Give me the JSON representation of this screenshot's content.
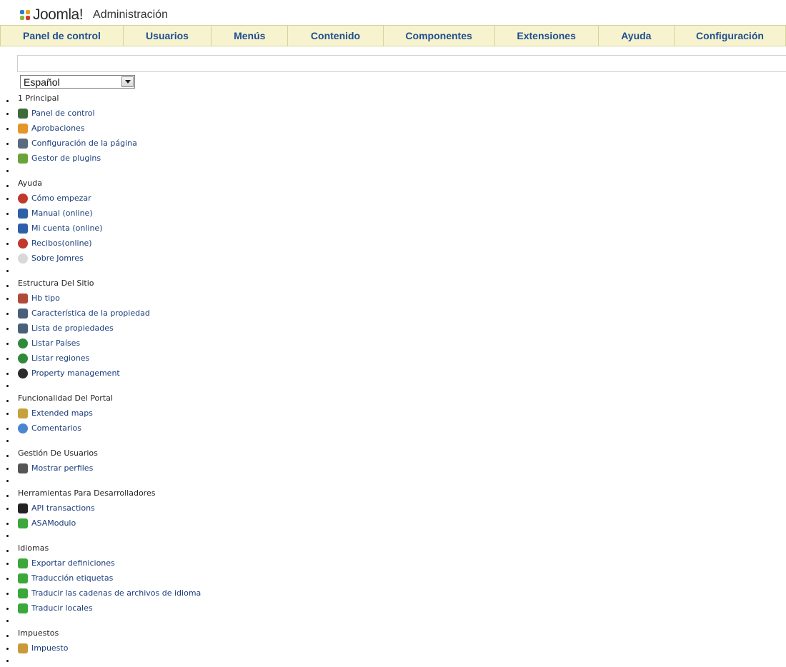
{
  "header": {
    "logo_text": "Joomla!",
    "title": "Administración"
  },
  "nav": [
    {
      "label": "Panel de control",
      "w": 172
    },
    {
      "label": "Usuarios",
      "w": 123
    },
    {
      "label": "Menús",
      "w": 107
    },
    {
      "label": "Contenido",
      "w": 133
    },
    {
      "label": "Componentes",
      "w": 156
    },
    {
      "label": "Extensiones",
      "w": 145
    },
    {
      "label": "Ayuda",
      "w": 106
    },
    {
      "label": "Configuración",
      "w": 156
    }
  ],
  "language_select": {
    "value": "Español"
  },
  "colors": {
    "menubar_bg": "#f7f3cf",
    "menubar_text": "#1f4f8f",
    "link": "#1a3d7a"
  },
  "sections": [
    {
      "title": "1 Principal",
      "items": [
        {
          "label": "Panel de control",
          "icon": "monitor-icon",
          "color": "#3f6b3a"
        },
        {
          "label": "Aprobaciones",
          "icon": "thumbs-up-icon",
          "color": "#e6952a"
        },
        {
          "label": "Configuración de la página",
          "icon": "globe-gear-icon",
          "color": "#5a6a80"
        },
        {
          "label": "Gestor de plugins",
          "icon": "puzzle-icon",
          "color": "#6aa33a"
        }
      ]
    },
    {
      "title": "Ayuda",
      "items": [
        {
          "label": "Cómo empezar",
          "icon": "lifebuoy-icon",
          "color": "#c0392b"
        },
        {
          "label": "Manual (online)",
          "icon": "help-book-icon",
          "color": "#2f5fa8"
        },
        {
          "label": "Mi cuenta (online)",
          "icon": "help-book-icon",
          "color": "#2f5fa8"
        },
        {
          "label": "Recibos(online)",
          "icon": "lifebuoy-icon",
          "color": "#c0392b"
        },
        {
          "label": "Sobre Jomres",
          "icon": "info-icon",
          "color": "#d8d8d8"
        }
      ]
    },
    {
      "title": "Estructura Del Sitio",
      "items": [
        {
          "label": "Hb tipo",
          "icon": "building-icon",
          "color": "#b04a3a"
        },
        {
          "label": "Característica de la propiedad",
          "icon": "city-icon",
          "color": "#4a5f7a"
        },
        {
          "label": "Lista de propiedades",
          "icon": "city-icon",
          "color": "#4a5f7a"
        },
        {
          "label": "Listar Países",
          "icon": "globe-icon",
          "color": "#2f8a3a"
        },
        {
          "label": "Listar regiones",
          "icon": "globe-icon",
          "color": "#2f8a3a"
        },
        {
          "label": "Property management",
          "icon": "disc-icon",
          "color": "#2b2b2b"
        }
      ]
    },
    {
      "title": "Funcionalidad Del Portal",
      "items": [
        {
          "label": "Extended maps",
          "icon": "map-icon",
          "color": "#c7a23a"
        },
        {
          "label": "Comentarios",
          "icon": "speech-bubble-icon",
          "color": "#4a86d0"
        }
      ]
    },
    {
      "title": "Gestión De Usuarios",
      "items": [
        {
          "label": "Mostrar perfiles",
          "icon": "user-profile-icon",
          "color": "#555555"
        }
      ]
    },
    {
      "title": "Herramientas Para Desarrolladores",
      "items": [
        {
          "label": "API transactions",
          "icon": "usb-stick-icon",
          "color": "#222222"
        },
        {
          "label": "ASAModulo",
          "icon": "spellcheck-icon",
          "color": "#3aa83a"
        }
      ]
    },
    {
      "title": "Idiomas",
      "items": [
        {
          "label": "Exportar definiciones",
          "icon": "spellcheck-icon",
          "color": "#3aa83a"
        },
        {
          "label": "Traducción etiquetas",
          "icon": "spellcheck-icon",
          "color": "#3aa83a"
        },
        {
          "label": "Traducir las cadenas de archivos de idioma",
          "icon": "spellcheck-icon",
          "color": "#3aa83a"
        },
        {
          "label": "Traducir locales",
          "icon": "spellcheck-icon",
          "color": "#3aa83a"
        }
      ]
    },
    {
      "title": "Impuestos",
      "items": [
        {
          "label": "Impuesto",
          "icon": "tax-icon",
          "color": "#c99a3a"
        }
      ]
    }
  ]
}
